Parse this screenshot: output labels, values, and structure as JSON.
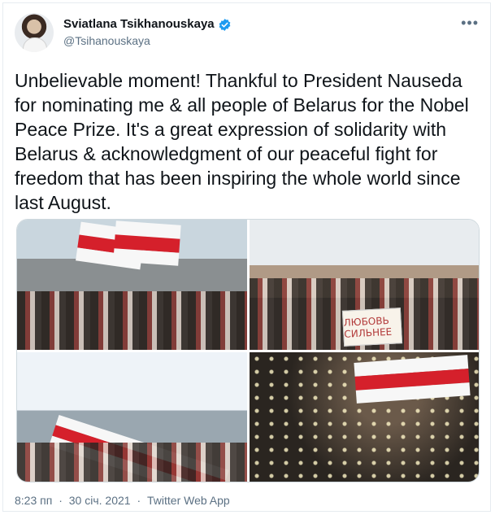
{
  "author": {
    "display_name": "Sviatlana Tsikhanouskaya",
    "handle": "@Tsihanouskaya",
    "verified": true
  },
  "menu_icon": "more-horizontal-icon",
  "tweet": {
    "text": "Unbelievable moment! Thankful to President Nauseda for nominating me & all people of Belarus for the Nobel Peace Prize. It's a great expression of solidarity with Belarus & acknowledgment of our peaceful fight for freedom that has been inspiring the whole world since last August."
  },
  "media": {
    "sign_text": "ЛЮБОВЬ СИЛЬНЕЕ"
  },
  "footer": {
    "time": "8:23 пп",
    "date": "30 січ. 2021",
    "separator": "·",
    "source": "Twitter Web App"
  },
  "colors": {
    "verified_blue": "#1d9bf0",
    "flag_red": "#d5202b",
    "secondary_text": "#5b7083"
  }
}
